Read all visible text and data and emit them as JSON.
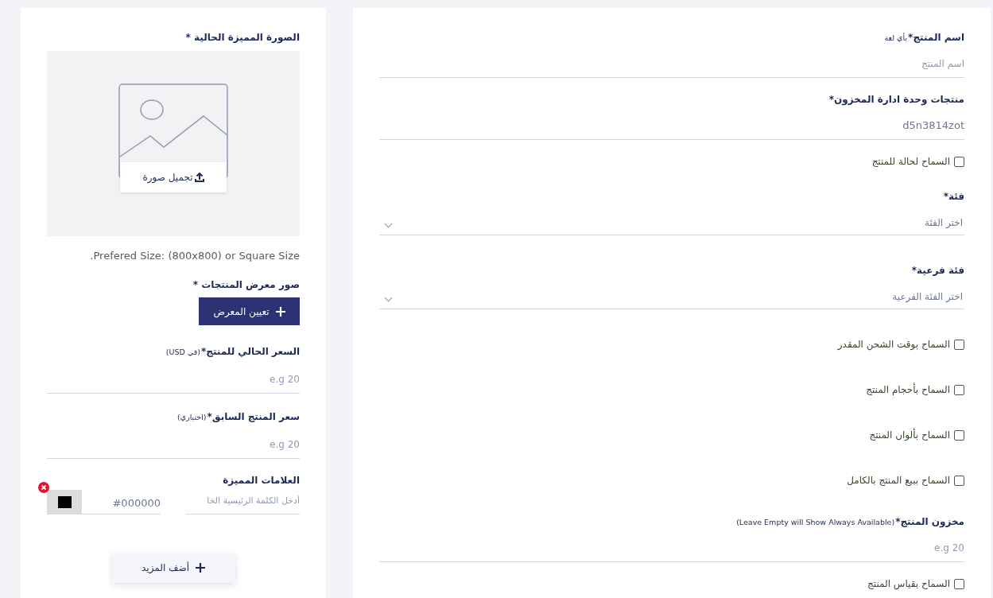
{
  "product_form": {
    "items": [
      {
        "kind": "field",
        "label": "اسم المنتج*",
        "note": "بأي لغة",
        "placeholder": "اسم المنتج"
      },
      {
        "kind": "field",
        "label": "منتجات وحدة ادارة المخزون*",
        "value": "d5n3814zot"
      },
      {
        "kind": "checkbox",
        "label": "السماح لحالة للمنتج",
        "checked": false
      },
      {
        "kind": "select",
        "label": "فئة*",
        "placeholder": "اختر الفئة"
      },
      {
        "kind": "select",
        "label": "فئة فرعية*",
        "placeholder": "اختر الفئة الفرعية"
      },
      {
        "kind": "checkbox",
        "label": "السماح بوقت الشحن المقدر",
        "checked": false
      },
      {
        "kind": "checkbox",
        "label": "السماح بأحجام المنتج",
        "checked": false
      },
      {
        "kind": "checkbox",
        "label": "السماح بألوان المنتج",
        "checked": false
      },
      {
        "kind": "checkbox",
        "label": "السماح ببيع المنتج بالكامل",
        "checked": false
      },
      {
        "kind": "field",
        "label": "مخزون المنتج*",
        "note": "(Leave Empty will Show Always Available)",
        "placeholder": "e.g 20"
      },
      {
        "kind": "checkbox",
        "label": "السماح بقياس المنتج",
        "checked": false
      }
    ]
  },
  "side_panel": {
    "featured_image": {
      "label": "الصورة المميزة الحالية *",
      "upload_button": "تجميل صورة",
      "hint": "Prefered Size: (800x800) or Square Size."
    },
    "gallery": {
      "label": "صور معرض المنتجات *",
      "button": "تعيين المعرض"
    },
    "price_fields": [
      {
        "label": "السعر الحالي للمنتج*",
        "note": "(في USD)",
        "placeholder": "e.g 20"
      },
      {
        "label": "سعر المنتج السابق*",
        "note": "(اختياري)",
        "placeholder": "e.g 20"
      }
    ],
    "tags": {
      "label": "العلامات المميزة",
      "keyword_placeholder": "أدخل الكلمة الرئيسية الخا",
      "color_value": "#000000",
      "color": "#000000",
      "add_button": "أضف المزيد"
    }
  }
}
